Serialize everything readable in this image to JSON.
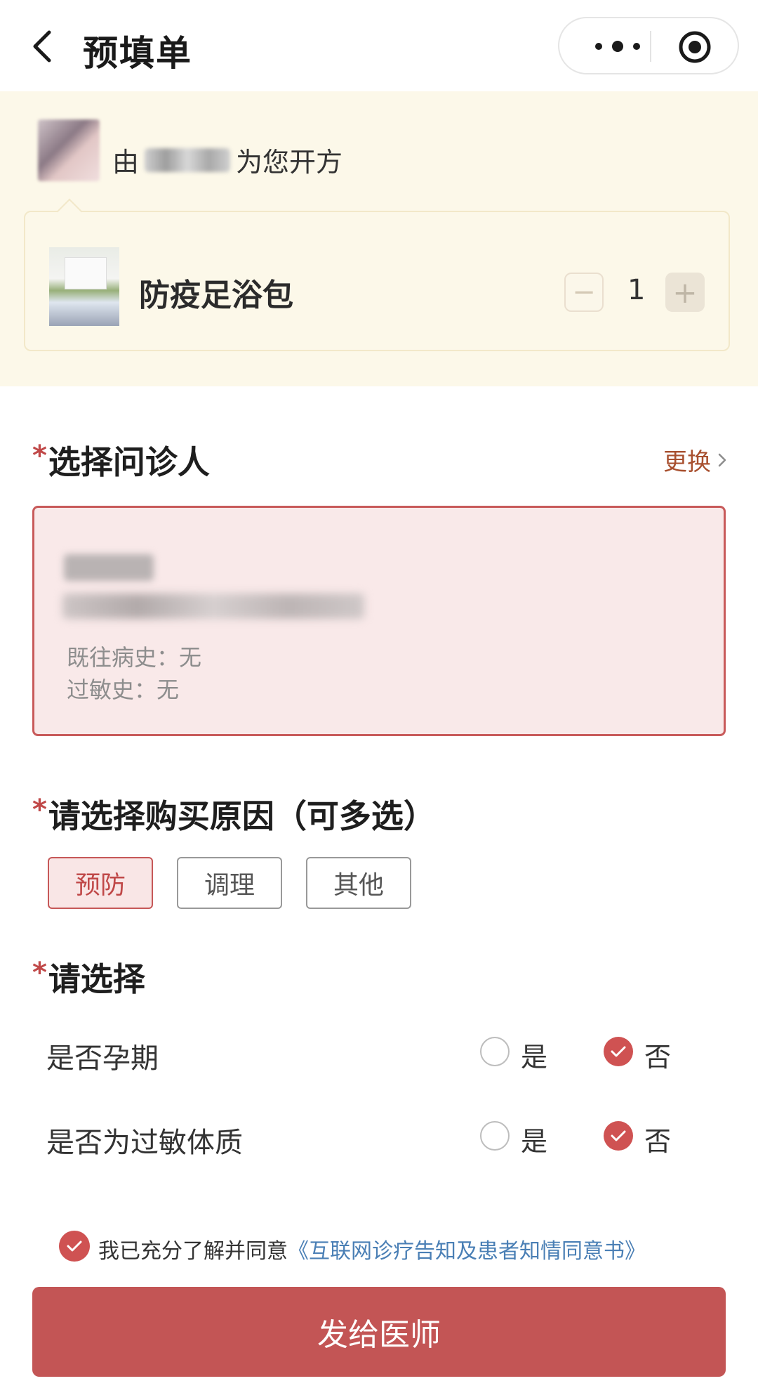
{
  "header": {
    "title": "预填单"
  },
  "prescription": {
    "by_prefix": "由",
    "by_suffix": "为您开方",
    "product": {
      "name": "防疫足浴包",
      "quantity": "1",
      "minus_symbol": "−",
      "plus_symbol": "+"
    }
  },
  "consultee": {
    "star": "*",
    "title": "选择问诊人",
    "change_label": "更换",
    "history_label": "既往病史：无",
    "allergy_label": "过敏史：无"
  },
  "reasons": {
    "star": "*",
    "title": "请选择购买原因（可多选）",
    "options": [
      "预防",
      "调理",
      "其他"
    ],
    "selected": "预防"
  },
  "choices": {
    "star": "*",
    "title": "请选择",
    "yes_label": "是",
    "no_label": "否",
    "questions": [
      {
        "label": "是否孕期",
        "value": "否"
      },
      {
        "label": "是否为过敏体质",
        "value": "否"
      }
    ]
  },
  "agreement": {
    "text": "我已充分了解并同意",
    "link_text": "《互联网诊疗告知及患者知情同意书》",
    "checked": true
  },
  "submit_label": "发给医师",
  "colors": {
    "accent": "#c35555",
    "link": "#4a7fb5",
    "rx_background": "#fcf8e9"
  },
  "icons": [
    "back-icon",
    "more-icon",
    "target-icon",
    "chevron-right-icon",
    "check-icon"
  ]
}
